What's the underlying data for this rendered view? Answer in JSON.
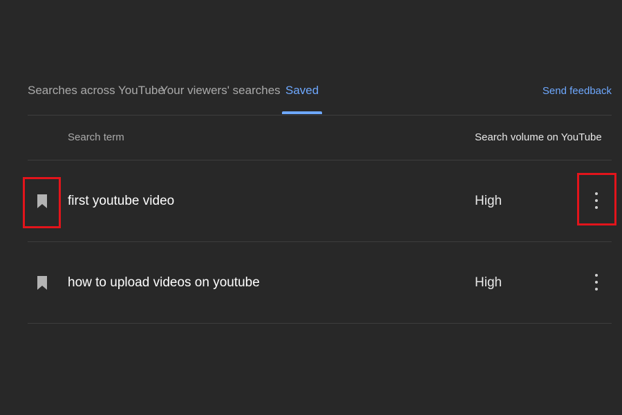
{
  "tabs": [
    {
      "label": "Searches across YouTube",
      "active": false
    },
    {
      "label": "Your viewers' searches",
      "active": false
    },
    {
      "label": "Saved",
      "active": true
    }
  ],
  "feedback_label": "Send feedback",
  "table": {
    "headers": {
      "term": "Search term",
      "volume": "Search volume on YouTube"
    },
    "rows": [
      {
        "term": "first youtube video",
        "volume": "High",
        "icon": "bookmark-icon"
      },
      {
        "term": "how to upload videos on youtube",
        "volume": "High",
        "icon": "bookmark-icon"
      }
    ]
  },
  "colors": {
    "background": "#282828",
    "accent": "#6ea8fe",
    "highlight": "#e3141b"
  }
}
